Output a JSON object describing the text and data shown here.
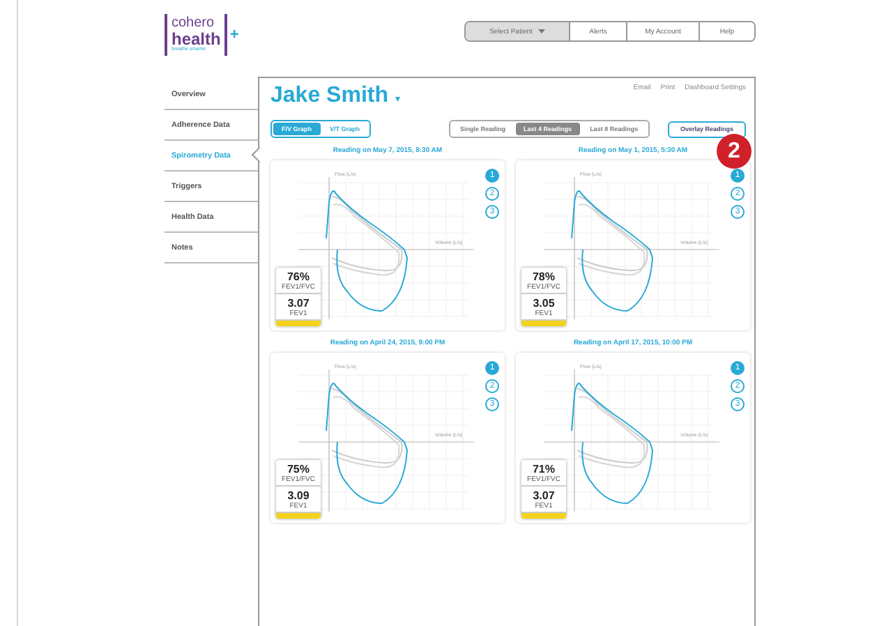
{
  "logo": {
    "word_top": "cohero",
    "word_bottom": "health",
    "plus": "+",
    "tagline": "breathe smarter"
  },
  "top_nav": [
    {
      "label": "Select Patient",
      "kind": "dropdown"
    },
    {
      "label": "Alerts",
      "kind": "link"
    },
    {
      "label": "My Account",
      "kind": "link"
    },
    {
      "label": "Help",
      "kind": "link"
    }
  ],
  "sidebar": {
    "items": [
      {
        "label": "Overview",
        "selected": false
      },
      {
        "label": "Adherence Data",
        "selected": false
      },
      {
        "label": "Spirometry Data",
        "selected": true
      },
      {
        "label": "Triggers",
        "selected": false
      },
      {
        "label": "Health Data",
        "selected": false
      },
      {
        "label": "Notes",
        "selected": false
      }
    ]
  },
  "patient": {
    "name": "Jake Smith",
    "caret": "▾"
  },
  "header_links": [
    "Email",
    "Print",
    "Dashboard Settings"
  ],
  "graph_tabs": [
    {
      "label": "F/V Graph",
      "selected": true
    },
    {
      "label": "V/T Graph",
      "selected": false
    }
  ],
  "reading_tabs": [
    {
      "label": "Single Reading",
      "selected": false
    },
    {
      "label": "Last 4 Readings",
      "selected": true
    },
    {
      "label": "Last 8 Readings",
      "selected": false
    }
  ],
  "overlay_button": "Overlay Readings",
  "step_badge": "2",
  "readings": [
    {
      "title": "Reading on May 7, 2015, 8:30 AM",
      "y_axis": "Flow (L/s)",
      "x_axis": "Volume (L/s)",
      "trials": [
        {
          "label": "1",
          "selected": true
        },
        {
          "label": "2",
          "selected": false
        },
        {
          "label": "3",
          "selected": false
        }
      ],
      "ratio": "76%",
      "ratio_label": "FEV1/FVC",
      "fev": "3.07",
      "fev_label": "FEV1"
    },
    {
      "title": "Reading on May 1, 2015, 5:30 AM",
      "y_axis": "Flow (L/s)",
      "x_axis": "Volume (L/s)",
      "trials": [
        {
          "label": "1",
          "selected": true
        },
        {
          "label": "2",
          "selected": false
        },
        {
          "label": "3",
          "selected": false
        }
      ],
      "ratio": "78%",
      "ratio_label": "FEV1/FVC",
      "fev": "3.05",
      "fev_label": "FEV1"
    },
    {
      "title": "Reading on April 24, 2015, 9:00 PM",
      "y_axis": "Flow (L/s)",
      "x_axis": "Volume (L/s)",
      "trials": [
        {
          "label": "1",
          "selected": true
        },
        {
          "label": "2",
          "selected": false
        },
        {
          "label": "3",
          "selected": false
        }
      ],
      "ratio": "75%",
      "ratio_label": "FEV1/FVC",
      "fev": "3.09",
      "fev_label": "FEV1"
    },
    {
      "title": "Reading on April 17, 2015, 10:00 PM",
      "y_axis": "Flow (L/s)",
      "x_axis": "Volume (L/s)",
      "trials": [
        {
          "label": "1",
          "selected": true
        },
        {
          "label": "2",
          "selected": false
        },
        {
          "label": "3",
          "selected": false
        }
      ],
      "ratio": "71%",
      "ratio_label": "FEV1/FVC",
      "fev": "3.07",
      "fev_label": "FEV1"
    }
  ]
}
